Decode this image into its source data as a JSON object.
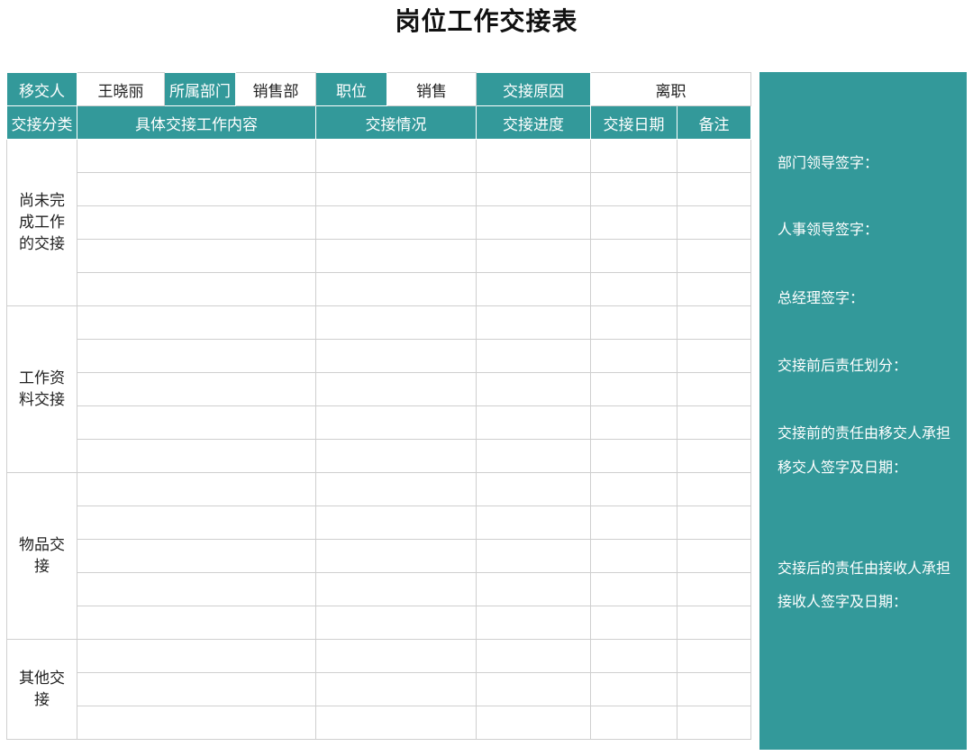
{
  "title": "岗位工作交接表",
  "header": {
    "handover_person_label": "移交人",
    "handover_person_value": "王晓丽",
    "department_label": "所属部门",
    "department_value": "销售部",
    "position_label": "职位",
    "position_value": "销售",
    "reason_label": "交接原因",
    "reason_value": "离职"
  },
  "columns": {
    "category": "交接分类",
    "content": "具体交接工作内容",
    "status": "交接情况",
    "progress": "交接进度",
    "date": "交接日期",
    "remark": "备注"
  },
  "categories": [
    {
      "label": "尚未完成工作的交接",
      "rows": 5
    },
    {
      "label": "工作资料交接",
      "rows": 5
    },
    {
      "label": "物品交接",
      "rows": 5
    },
    {
      "label": "其他交接",
      "rows": 3
    }
  ],
  "signatures": {
    "dept_leader": "部门领导签字：",
    "hr_leader": "人事领导签字：",
    "general_manager": "总经理签字：",
    "responsibility_split": "交接前后责任划分：",
    "before_responsibility": "交接前的责任由移交人承担",
    "handover_sign": "移交人签字及日期：",
    "after_responsibility": "交接后的责任由接收人承担",
    "receiver_sign": "接收人签字及日期："
  },
  "colors": {
    "accent": "#33999a",
    "grid": "#cfcfcf"
  }
}
